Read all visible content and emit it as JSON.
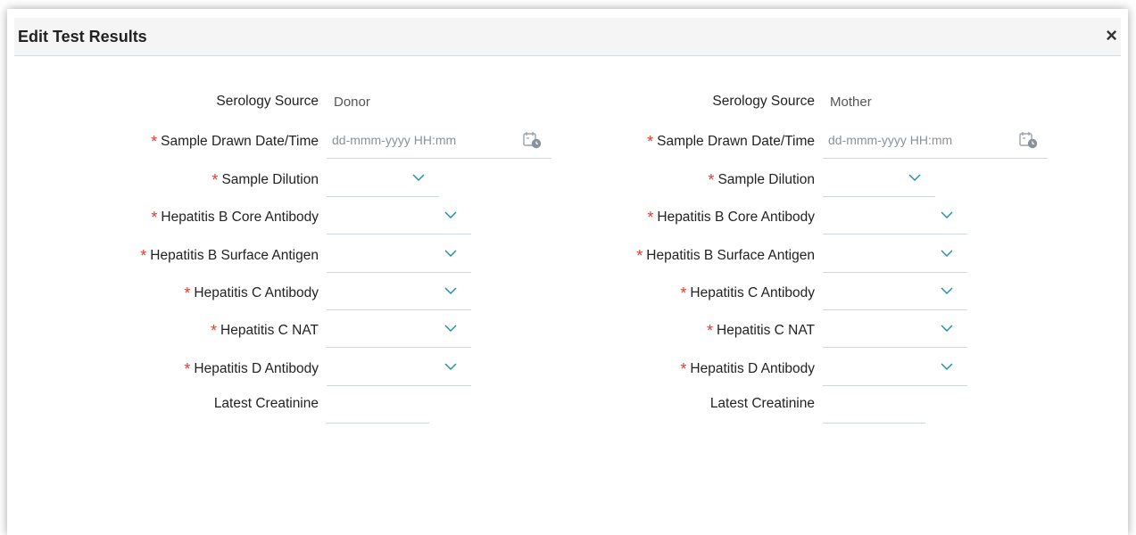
{
  "dialog": {
    "title": "Edit Test Results",
    "close_label": "×"
  },
  "left": {
    "serology_label": "Serology Source",
    "serology_value": "Donor",
    "date_label": "Sample Drawn Date/Time",
    "date_placeholder": "dd-mmm-yyyy HH:mm",
    "dilution_label": "Sample Dilution",
    "hbc_label": "Hepatitis B Core Antibody",
    "hbs_label": "Hepatitis B Surface Antigen",
    "hcv_ab_label": "Hepatitis C Antibody",
    "hcv_nat_label": "Hepatitis C NAT",
    "hdv_label": "Hepatitis D Antibody",
    "creat_label": "Latest Creatinine"
  },
  "right": {
    "serology_label": "Serology Source",
    "serology_value": "Mother",
    "date_label": "Sample Drawn Date/Time",
    "date_placeholder": "dd-mmm-yyyy HH:mm",
    "dilution_label": "Sample Dilution",
    "hbc_label": "Hepatitis B Core Antibody",
    "hbs_label": "Hepatitis B Surface Antigen",
    "hcv_ab_label": "Hepatitis C Antibody",
    "hcv_nat_label": "Hepatitis C NAT",
    "hdv_label": "Hepatitis D Antibody",
    "creat_label": "Latest Creatinine"
  },
  "required_marker": "*",
  "colors": {
    "required": "#e03c31",
    "chevron": "#1a8fa8",
    "underline": "#cfd6dc",
    "header_bg": "#f5f5f5"
  },
  "icons": {
    "dropdown": "chevron-down-icon",
    "calendar": "calendar-clock-icon",
    "close": "close-icon"
  }
}
